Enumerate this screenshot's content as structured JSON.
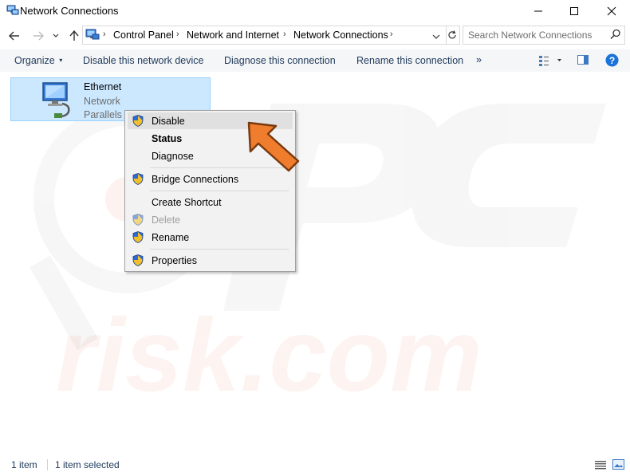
{
  "window": {
    "title": "Network Connections"
  },
  "address": {
    "crumbs": [
      "Control Panel",
      "Network and Internet",
      "Network Connections"
    ],
    "search_placeholder": "Search Network Connections"
  },
  "toolbar": {
    "organize": "Organize",
    "disable_device": "Disable this network device",
    "diagnose": "Diagnose this connection",
    "rename": "Rename this connection",
    "more": "»"
  },
  "item": {
    "name": "Ethernet",
    "status": "Network",
    "adapter": "Parallels E"
  },
  "context_menu": {
    "items": [
      {
        "label": "Disable",
        "shield": true,
        "bold": false,
        "disabled": false,
        "highlighted": true
      },
      {
        "label": "Status",
        "shield": false,
        "bold": true,
        "disabled": false
      },
      {
        "label": "Diagnose",
        "shield": false,
        "bold": false,
        "disabled": false
      },
      {
        "label": "Bridge Connections",
        "shield": true,
        "bold": false,
        "disabled": false
      },
      {
        "label": "Create Shortcut",
        "shield": false,
        "bold": false,
        "disabled": false
      },
      {
        "label": "Delete",
        "shield": true,
        "bold": false,
        "disabled": true
      },
      {
        "label": "Rename",
        "shield": true,
        "bold": false,
        "disabled": false
      },
      {
        "label": "Properties",
        "shield": true,
        "bold": false,
        "disabled": false
      }
    ]
  },
  "status": {
    "count": "1 item",
    "selected": "1 item selected"
  },
  "colors": {
    "selection_fill": "#cce8ff",
    "toolbar_text": "#1e395b",
    "arrow": "#f07c2e",
    "help": "#1a73d9"
  },
  "watermark": {
    "text": "PC risk.com"
  }
}
